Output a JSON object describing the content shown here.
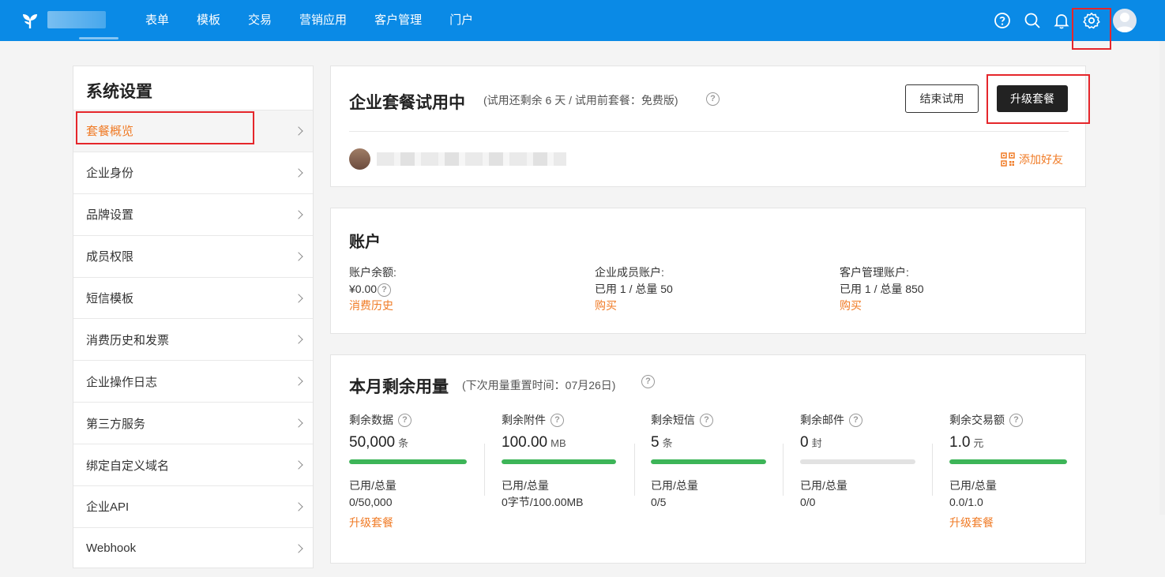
{
  "nav": {
    "items": [
      "表单",
      "模板",
      "交易",
      "营销应用",
      "客户管理",
      "门户"
    ]
  },
  "sidebar": {
    "title": "系统设置",
    "items": [
      "套餐概览",
      "企业身份",
      "品牌设置",
      "成员权限",
      "短信模板",
      "消费历史和发票",
      "企业操作日志",
      "第三方服务",
      "绑定自定义域名",
      "企业API",
      "Webhook"
    ]
  },
  "plan": {
    "title": "企业套餐试用中",
    "subtitle": "(试用还剩余 6 天 / 试用前套餐：免费版)",
    "end_trial": "结束试用",
    "upgrade": "升级套餐",
    "add_friend": "添加好友"
  },
  "account": {
    "title": "账户",
    "balance_label": "账户余额:",
    "balance_value": "¥0.00",
    "balance_link": "消费历史",
    "members_label": "企业成员账户:",
    "members_value": "已用 1 / 总量 50",
    "members_link": "购买",
    "crm_label": "客户管理账户:",
    "crm_value": "已用 1 / 总量 850",
    "crm_link": "购买"
  },
  "usage": {
    "title": "本月剩余用量",
    "subtitle": "(下次用量重置时间：07月26日)",
    "stats": [
      {
        "label": "剩余数据",
        "value": "50,000",
        "unit": "条",
        "fill": 1.0,
        "used_label": "已用/总量",
        "used_value": "0/50,000",
        "link": "升级套餐"
      },
      {
        "label": "剩余附件",
        "value": "100.00",
        "unit": "MB",
        "fill": 1.0,
        "used_label": "已用/总量",
        "used_value": "0字节/100.00MB",
        "link": ""
      },
      {
        "label": "剩余短信",
        "value": "5",
        "unit": "条",
        "fill": 1.0,
        "used_label": "已用/总量",
        "used_value": "0/5",
        "link": ""
      },
      {
        "label": "剩余邮件",
        "value": "0",
        "unit": "封",
        "fill": 0.0,
        "used_label": "已用/总量",
        "used_value": "0/0",
        "link": ""
      },
      {
        "label": "剩余交易额",
        "value": "1.0",
        "unit": "元",
        "fill": 1.0,
        "used_label": "已用/总量",
        "used_value": "0.0/1.0",
        "link": "升级套餐"
      }
    ]
  },
  "colors": {
    "topbar": "#0a8ae6",
    "accent_orange": "#f07b26",
    "progress_green": "#3db558",
    "highlight_red": "#e5262b"
  },
  "icons": [
    "app-logo-icon",
    "help-icon",
    "search-icon",
    "bell-icon",
    "gear-icon",
    "user-avatar-icon",
    "question-icon",
    "chevron-right-icon",
    "qr-code-icon"
  ]
}
